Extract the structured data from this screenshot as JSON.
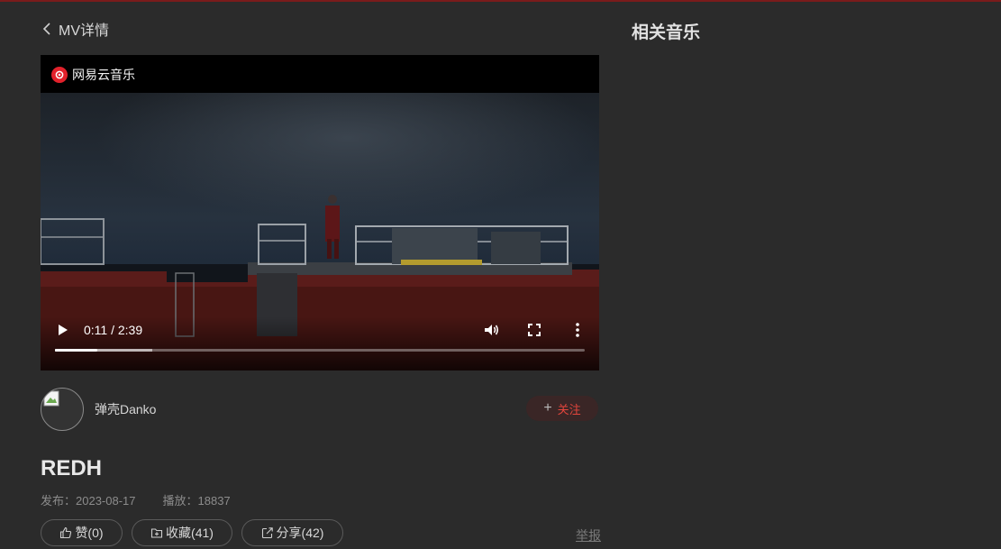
{
  "header": {
    "back_label": "MV详情"
  },
  "player": {
    "brand": "网易云音乐",
    "time_display": "0:11 / 2:39",
    "progress_fraction": 0.08,
    "buffered_fraction": 0.184
  },
  "author": {
    "name": "弹壳Danko",
    "follow_label": "关注"
  },
  "mv": {
    "title": "REDH",
    "publish": "发布：2023-08-17",
    "plays": "播放：18837"
  },
  "actions": {
    "like": "赞(0)",
    "favorite": "收藏(41)",
    "share": "分享(42)",
    "report": "举报"
  },
  "sidebar": {
    "title": "相关音乐"
  },
  "icons": [
    "chevron-left-icon",
    "netease-logo-icon",
    "play-icon",
    "volume-icon",
    "fullscreen-icon",
    "more-vertical-icon",
    "thumbs-up-icon",
    "folder-plus-icon",
    "share-icon",
    "plus-icon"
  ],
  "colors": {
    "background": "#2b2b2b",
    "accent_red": "#e2453c",
    "top_line": "#7a1b1b"
  }
}
